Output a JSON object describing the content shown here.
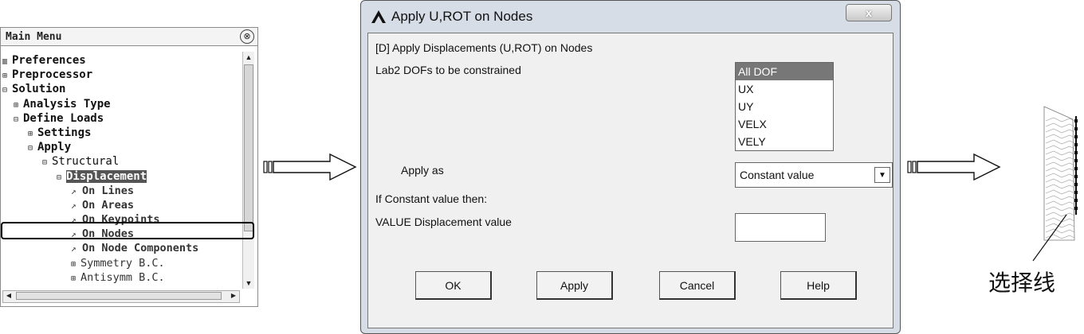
{
  "main_menu": {
    "title": "Main Menu",
    "header_icon": "double-chevron-icon",
    "items": [
      {
        "label": "Preferences",
        "marker": "▥"
      },
      {
        "label": "Preprocessor",
        "marker": "⊞"
      },
      {
        "label": "Solution",
        "marker": "⊟"
      },
      {
        "label": "Analysis Type",
        "marker": "⊞"
      },
      {
        "label": "Define Loads",
        "marker": "⊟"
      },
      {
        "label": "Settings",
        "marker": "⊞"
      },
      {
        "label": "Apply",
        "marker": "⊟"
      },
      {
        "label": "Structural",
        "marker": "⊟"
      },
      {
        "label": "Displacement",
        "marker": "⊟"
      },
      {
        "label": "On Lines",
        "marker": "↗"
      },
      {
        "label": "On Areas",
        "marker": "↗"
      },
      {
        "label": "On Keypoints",
        "marker": "↗"
      },
      {
        "label": "On Nodes",
        "marker": "↗"
      },
      {
        "label": "On Node Components",
        "marker": "↗"
      },
      {
        "label": "Symmetry B.C.",
        "marker": "⊞"
      },
      {
        "label": "Antisymm B.C.",
        "marker": "⊞"
      }
    ]
  },
  "dialog": {
    "title": "Apply U,ROT on Nodes",
    "close_glyph": "x",
    "heading": "[D]  Apply Displacements (U,ROT) on Nodes",
    "lab2_label": "Lab2    DOFs to be constrained",
    "dof_options": [
      "All DOF",
      "UX",
      "UY",
      "VELX",
      "VELY"
    ],
    "dof_selected": "All DOF",
    "apply_as_label": "Apply as",
    "apply_as_value": "Constant value",
    "if_constant_label": "If Constant value then:",
    "value_label": "VALUE   Displacement value",
    "value_input": "",
    "buttons": {
      "ok": "OK",
      "apply": "Apply",
      "cancel": "Cancel",
      "help": "Help"
    }
  },
  "annotation": {
    "label": "选择线"
  },
  "colors": {
    "dialog_frame": "#d6dde6",
    "dialog_client": "#f0f0f0",
    "selected_item": "#777777",
    "highlight_box": "#000000"
  }
}
